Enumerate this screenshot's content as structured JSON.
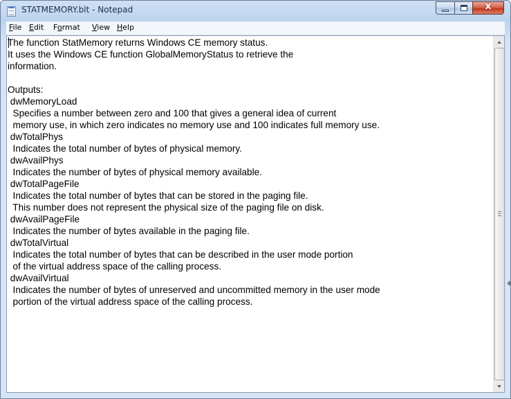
{
  "window": {
    "title": "STATMEMORY.blt - Notepad",
    "close_glyph": "x"
  },
  "menu": {
    "file": {
      "mnemonic": "F",
      "rest": "ile"
    },
    "edit": {
      "mnemonic": "E",
      "rest": "dit"
    },
    "format": {
      "mnemonic": "o",
      "pre": "F",
      "rest": "rmat"
    },
    "view": {
      "mnemonic": "V",
      "rest": "iew"
    },
    "help": {
      "mnemonic": "H",
      "rest": "elp"
    }
  },
  "document": {
    "lines": [
      "The function StatMemory returns Windows CE memory status.",
      "It uses the Windows CE function GlobalMemoryStatus to retrieve the",
      "information.",
      "",
      "Outputs:",
      " dwMemoryLoad",
      "  Specifies a number between zero and 100 that gives a general idea of current",
      "  memory use, in which zero indicates no memory use and 100 indicates full memory use.",
      " dwTotalPhys",
      "  Indicates the total number of bytes of physical memory.",
      " dwAvailPhys",
      "  Indicates the number of bytes of physical memory available.",
      " dwTotalPageFile",
      "  Indicates the total number of bytes that can be stored in the paging file.",
      "  This number does not represent the physical size of the paging file on disk.",
      " dwAvailPageFile",
      "  Indicates the number of bytes available in the paging file.",
      " dwTotalVirtual",
      "  Indicates the total number of bytes that can be described in the user mode portion",
      "  of the virtual address space of the calling process.",
      " dwAvailVirtual",
      "  Indicates the number of bytes of unreserved and uncommitted memory in the user mode",
      "  portion of the virtual address space of the calling process."
    ]
  },
  "colors": {
    "titlebar": "#bcd3ee",
    "close_button": "#c1391b",
    "text": "#000000"
  }
}
